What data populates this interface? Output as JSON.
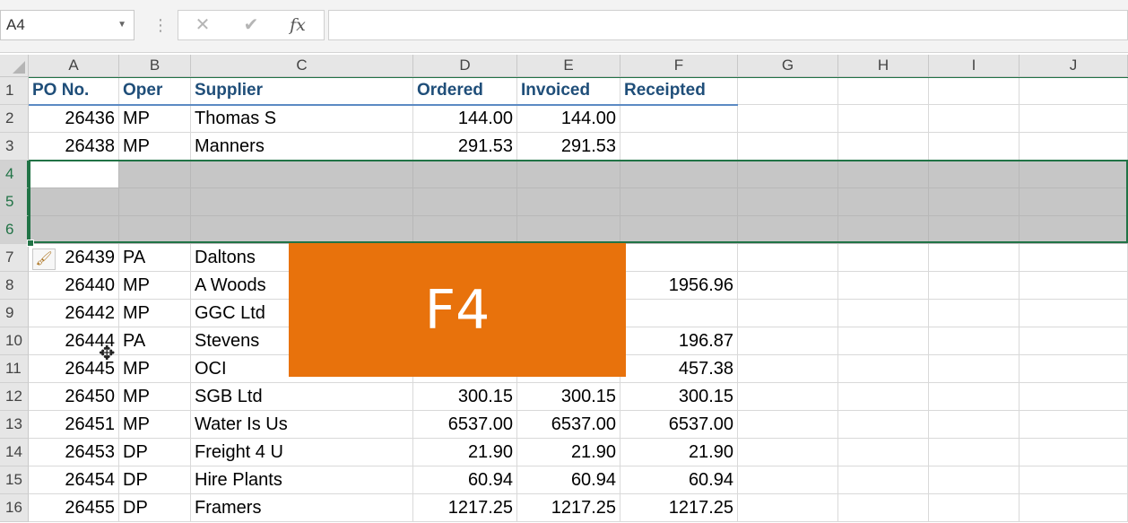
{
  "formula_bar": {
    "name_box": "A4",
    "cancel_icon": "✕",
    "enter_icon": "✔",
    "function_icon": "fx",
    "formula_value": ""
  },
  "columns": [
    "A",
    "B",
    "C",
    "D",
    "E",
    "F",
    "G",
    "H",
    "I",
    "J"
  ],
  "rows": [
    "1",
    "2",
    "3",
    "4",
    "5",
    "6",
    "7",
    "8",
    "9",
    "10",
    "11",
    "12",
    "13",
    "14",
    "15",
    "16"
  ],
  "headers": {
    "A": "PO No.",
    "B": "Oper",
    "C": "Supplier",
    "D": "Ordered",
    "E": "Invoiced",
    "F": "Receipted"
  },
  "data_rows": [
    {
      "row": "2",
      "A": "26436",
      "B": "MP",
      "C": "Thomas S",
      "D": "144.00",
      "E": "144.00",
      "F": ""
    },
    {
      "row": "3",
      "A": "26438",
      "B": "MP",
      "C": "Manners",
      "D": "291.53",
      "E": "291.53",
      "F": ""
    },
    {
      "row": "7",
      "A": "26439",
      "B": "PA",
      "C": "Daltons",
      "D": "",
      "E": "",
      "F": ""
    },
    {
      "row": "8",
      "A": "26440",
      "B": "MP",
      "C": "A Woods",
      "D": "",
      "E": "",
      "F": "1956.96"
    },
    {
      "row": "9",
      "A": "26442",
      "B": "MP",
      "C": "GGC Ltd",
      "D": "",
      "E": "",
      "F": ""
    },
    {
      "row": "10",
      "A": "26444",
      "B": "PA",
      "C": "Stevens",
      "D": "",
      "E": "",
      "F": "196.87"
    },
    {
      "row": "11",
      "A": "26445",
      "B": "MP",
      "C": "OCI",
      "D": "",
      "E": "",
      "F": "457.38"
    },
    {
      "row": "12",
      "A": "26450",
      "B": "MP",
      "C": "SGB Ltd",
      "D": "300.15",
      "E": "300.15",
      "F": "300.15"
    },
    {
      "row": "13",
      "A": "26451",
      "B": "MP",
      "C": "Water Is Us",
      "D": "6537.00",
      "E": "6537.00",
      "F": "6537.00"
    },
    {
      "row": "14",
      "A": "26453",
      "B": "DP",
      "C": "Freight 4 U",
      "D": "21.90",
      "E": "21.90",
      "F": "21.90"
    },
    {
      "row": "15",
      "A": "26454",
      "B": "DP",
      "C": "Hire Plants",
      "D": "60.94",
      "E": "60.94",
      "F": "60.94"
    },
    {
      "row": "16",
      "A": "26455",
      "B": "DP",
      "C": "Framers",
      "D": "1217.25",
      "E": "1217.25",
      "F": "1217.25"
    }
  ],
  "selected_rows": [
    "4",
    "5",
    "6"
  ],
  "active_cell": "A4",
  "overlay": {
    "text": "F4",
    "color": "#e8720c"
  },
  "colors": {
    "header_text": "#1f4e79",
    "selection_border": "#217346",
    "selection_fill": "#c6c6c6"
  }
}
